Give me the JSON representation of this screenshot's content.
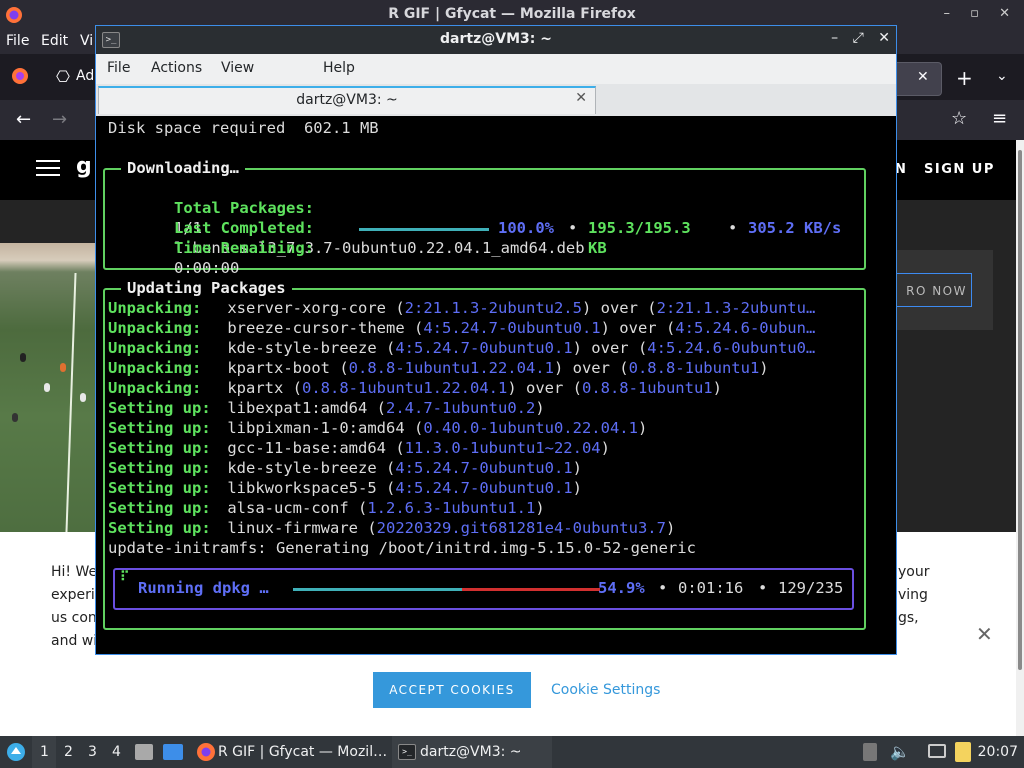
{
  "firefox": {
    "window_title": "R GIF | Gfycat — Mozilla Firefox",
    "menu": [
      "File",
      "Edit",
      "Vi"
    ],
    "tab_partial_label": "Ad",
    "site": {
      "sign_up": "SIGN UP",
      "nav_partial": "N",
      "promo_button": "RO NOW",
      "cookie_text_left": [
        "Hi! We",
        "experie",
        "us con",
        "and wi"
      ],
      "cookie_text_right": [
        "your",
        "ving",
        "gs,"
      ],
      "accept_cookies": "ACCEPT COOKIES",
      "cookie_settings": "Cookie Settings"
    }
  },
  "konsole": {
    "window_title": "dartz@VM3: ~",
    "menu": [
      "File",
      "Actions",
      "View",
      "Help"
    ],
    "tab_label": "dartz@VM3: ~",
    "terminal": {
      "disk_line": "Disk space required  602.1 MB",
      "download_box": {
        "title": "Downloading…",
        "total_label": "Total Packages:",
        "total_value": "1/1",
        "last_label": "Last Completed:",
        "last_value": "libuno-sal3_7.3.7-0ubuntu0.22.04.1_amd64.deb",
        "time_label": "Time Remaining:",
        "time_value": "0:00:00",
        "percent": "100.0%",
        "sep": "•",
        "size": "195.3/195.3",
        "size_unit": "KB",
        "speed": "305.2 KB/s",
        "progress": 1.0
      },
      "updating_box": {
        "title": "Updating Packages",
        "lines": [
          {
            "action": "Unpacking:",
            "pkg": "xserver-xorg-core ",
            "paren1": "(",
            "v1": "2:21.1.3-2ubuntu2.5",
            "mid": ") over (",
            "v2": "2:21.1.3-2ubuntu…",
            "end": ""
          },
          {
            "action": "Unpacking:",
            "pkg": "breeze-cursor-theme ",
            "paren1": "(",
            "v1": "4:5.24.7-0ubuntu0.1",
            "mid": ") over (",
            "v2": "4:5.24.6-0ubun…",
            "end": ""
          },
          {
            "action": "Unpacking:",
            "pkg": "kde-style-breeze ",
            "paren1": "(",
            "v1": "4:5.24.7-0ubuntu0.1",
            "mid": ") over (",
            "v2": "4:5.24.6-0ubuntu0…",
            "end": ""
          },
          {
            "action": "Unpacking:",
            "pkg": "kpartx-boot ",
            "paren1": "(",
            "v1": "0.8.8-1ubuntu1.22.04.1",
            "mid": ") over (",
            "v2": "0.8.8-1ubuntu1",
            "end": ")"
          },
          {
            "action": "Unpacking:",
            "pkg": "kpartx ",
            "paren1": "(",
            "v1": "0.8.8-1ubuntu1.22.04.1",
            "mid": ") over (",
            "v2": "0.8.8-1ubuntu1",
            "end": ")"
          },
          {
            "action": "Setting up:",
            "pkg": "libexpat1:amd64 ",
            "paren1": "(",
            "v1": "2.4.7-1ubuntu0.2",
            "mid": ")",
            "v2": "",
            "end": ""
          },
          {
            "action": "Setting up:",
            "pkg": "libpixman-1-0:amd64 ",
            "paren1": "(",
            "v1": "0.40.0-1ubuntu0.22.04.1",
            "mid": ")",
            "v2": "",
            "end": ""
          },
          {
            "action": "Setting up:",
            "pkg": "gcc-11-base:amd64 ",
            "paren1": "(",
            "v1": "11.3.0-1ubuntu1~22.04",
            "mid": ")",
            "v2": "",
            "end": ""
          },
          {
            "action": "Setting up:",
            "pkg": "kde-style-breeze ",
            "paren1": "(",
            "v1": "4:5.24.7-0ubuntu0.1",
            "mid": ")",
            "v2": "",
            "end": ""
          },
          {
            "action": "Setting up:",
            "pkg": "libkworkspace5-5 ",
            "paren1": "(",
            "v1": "4:5.24.7-0ubuntu0.1",
            "mid": ")",
            "v2": "",
            "end": ""
          },
          {
            "action": "Setting up:",
            "pkg": "alsa-ucm-conf ",
            "paren1": "(",
            "v1": "1.2.6.3-1ubuntu1.1",
            "mid": ")",
            "v2": "",
            "end": ""
          },
          {
            "action": "Setting up:",
            "pkg": "linux-firmware ",
            "paren1": "(",
            "v1": "20220329.git681281e4-0ubuntu3.7",
            "mid": ")",
            "v2": "",
            "end": ""
          }
        ],
        "initramfs_line": "update-initramfs: Generating /boot/initrd.img-5.15.0-52-generic"
      },
      "dpkg_box": {
        "spinner": "⠏",
        "label": "Running dpkg …",
        "percent": "54.9%",
        "elapsed": "0:01:16",
        "count": "129/235",
        "progress": 0.549
      }
    }
  },
  "taskbar": {
    "desktops": [
      "1",
      "2",
      "3",
      "4"
    ],
    "firefox_task": "R GIF | Gfycat — Mozil…",
    "konsole_task": "dartz@VM3: ~",
    "clock": "20:07"
  },
  "colors": {
    "konsole_border": "#3d8ee9",
    "term_green": "#5ee25e",
    "term_blue": "#5e6ef5",
    "dpkg_box": "#6a4fe0",
    "cookie_button": "#3598db"
  }
}
